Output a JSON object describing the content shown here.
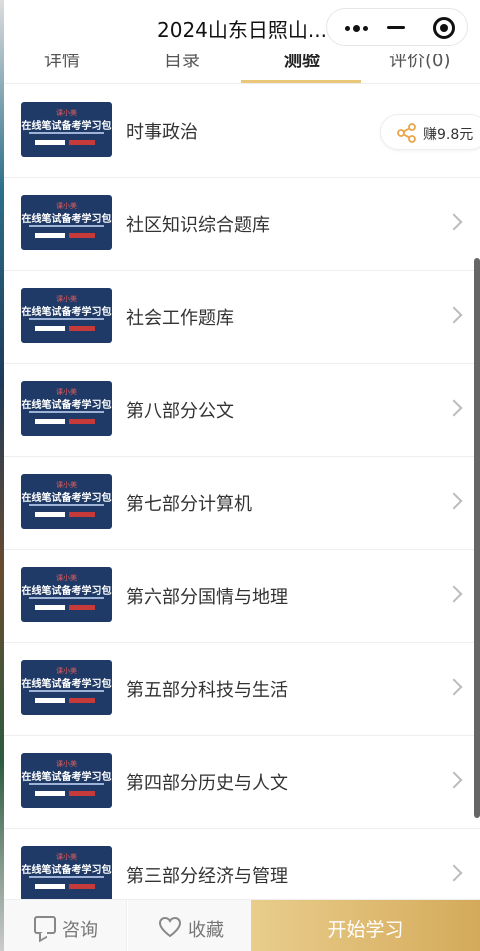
{
  "window": {
    "title": "2024山东日照山..."
  },
  "tabs": [
    {
      "label": "详情"
    },
    {
      "label": "目录"
    },
    {
      "label": "测验"
    },
    {
      "label": "评价(0)"
    }
  ],
  "earn_badge": {
    "label": "赚9.8元"
  },
  "thumbnail": {
    "brand": "课小美",
    "headline": "在线笔试备考学习包"
  },
  "items": [
    {
      "label": "时事政治"
    },
    {
      "label": "社区知识综合题库"
    },
    {
      "label": "社会工作题库"
    },
    {
      "label": "第八部分公文"
    },
    {
      "label": "第七部分计算机"
    },
    {
      "label": "第六部分国情与地理"
    },
    {
      "label": "第五部分科技与生活"
    },
    {
      "label": "第四部分历史与人文"
    },
    {
      "label": "第三部分经济与管理"
    }
  ],
  "bottom_bar": {
    "consult": "咨询",
    "favorite": "收藏",
    "start": "开始学习"
  },
  "colors": {
    "accent": "#e8c878",
    "start_button": "#d4aa5a",
    "share_icon": "#e8a64a",
    "thumb_bg": "#1f3a66"
  }
}
